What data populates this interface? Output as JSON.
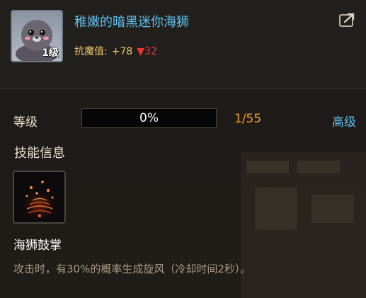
{
  "pet": {
    "name": "稚嫩的暗黑迷你海狮",
    "level_badge": "1级",
    "stat_label": "抗魔值:",
    "stat_bonus": "+78",
    "stat_down_arrow": "▼",
    "stat_decrease": "32",
    "icon": "seal-portrait-icon"
  },
  "share_icon": "share-icon",
  "level": {
    "label": "等级",
    "progress_text": "0%",
    "progress_fraction": 0,
    "count": "1/55",
    "advanced_link": "高级"
  },
  "skills": {
    "section_title": "技能信息",
    "skill_name": "海狮鼓掌",
    "skill_icon": "whirlwind-skill-icon",
    "skill_description": "攻击时，有30%的概率生成旋风（冷却时间2秒）。"
  },
  "colors": {
    "name_blue": "#5fc1f0",
    "stat_gold": "#f0c56a",
    "decrease_red": "#f03535",
    "count_orange": "#f0a020"
  }
}
